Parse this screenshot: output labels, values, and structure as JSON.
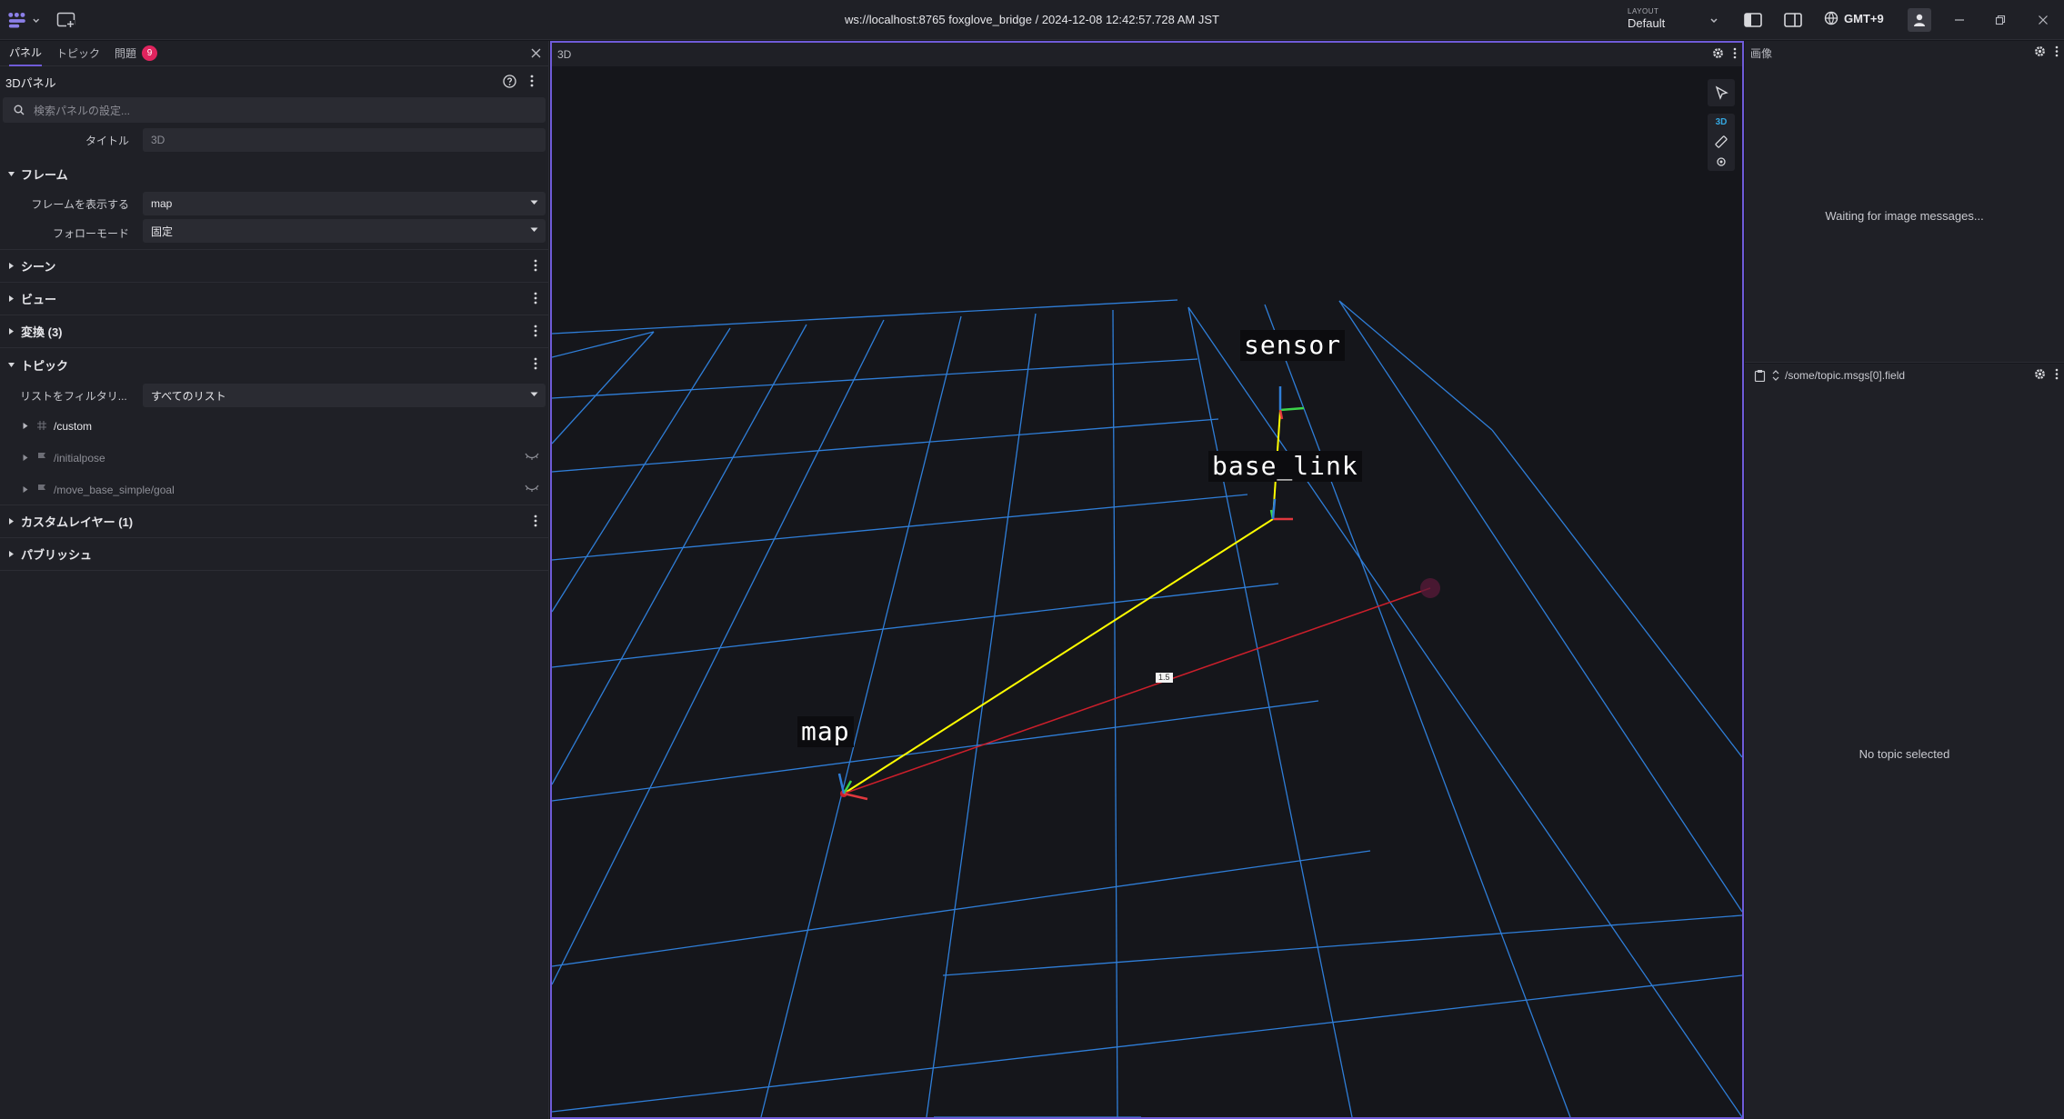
{
  "appbar": {
    "connection_title": "ws://localhost:8765 foxglove_bridge / 2024-12-08 12:42:57.728 AM JST",
    "layout_label": "LAYOUT",
    "layout_value": "Default",
    "timezone": "GMT+9"
  },
  "sidebar": {
    "tabs": [
      {
        "label": "パネル",
        "active": true
      },
      {
        "label": "トピック",
        "active": false
      },
      {
        "label": "問題",
        "badge": "9",
        "active": false
      }
    ],
    "panel_title": "3Dパネル",
    "search_placeholder": "検索パネルの設定...",
    "title_field": {
      "label": "タイトル",
      "value": "3D"
    },
    "sections": {
      "frame": "フレーム",
      "scene": "シーン",
      "view": "ビュー",
      "transforms": "変換 (3)",
      "topics": "トピック",
      "custom_layers": "カスタムレイヤー (1)",
      "publish": "パブリッシュ"
    },
    "frame_fields": [
      {
        "label": "フレームを表示する",
        "value": "map"
      },
      {
        "label": "フォローモード",
        "value": "固定"
      }
    ],
    "topic_filter": {
      "label": "リストをフィルタリ...",
      "value": "すべてのリスト"
    },
    "topics": [
      {
        "name": "/custom",
        "icon": "grid-icon",
        "dim": false
      },
      {
        "name": "/initialpose",
        "icon": "flag-icon",
        "dim": true
      },
      {
        "name": "/move_base_simple/goal",
        "icon": "flag-icon",
        "dim": true
      }
    ]
  },
  "panel3d": {
    "title": "3D",
    "toolbar_3d": "3D",
    "frames": [
      {
        "name": "sensor"
      },
      {
        "name": "base_link"
      },
      {
        "name": "map"
      }
    ],
    "measure_label": "1.5"
  },
  "image_panel": {
    "title": "画像",
    "message": "Waiting for image messages..."
  },
  "raw_panel": {
    "path": "/some/topic.msgs[0].field",
    "message": "No topic selected"
  },
  "colors": {
    "accent": "#6f5bd8",
    "grid": "#2f7ed8",
    "tf_line": "#ffff00",
    "measure_line": "#cc1f2b",
    "badge": "#e0245e",
    "toolbar_3d": "#34a7e0"
  }
}
